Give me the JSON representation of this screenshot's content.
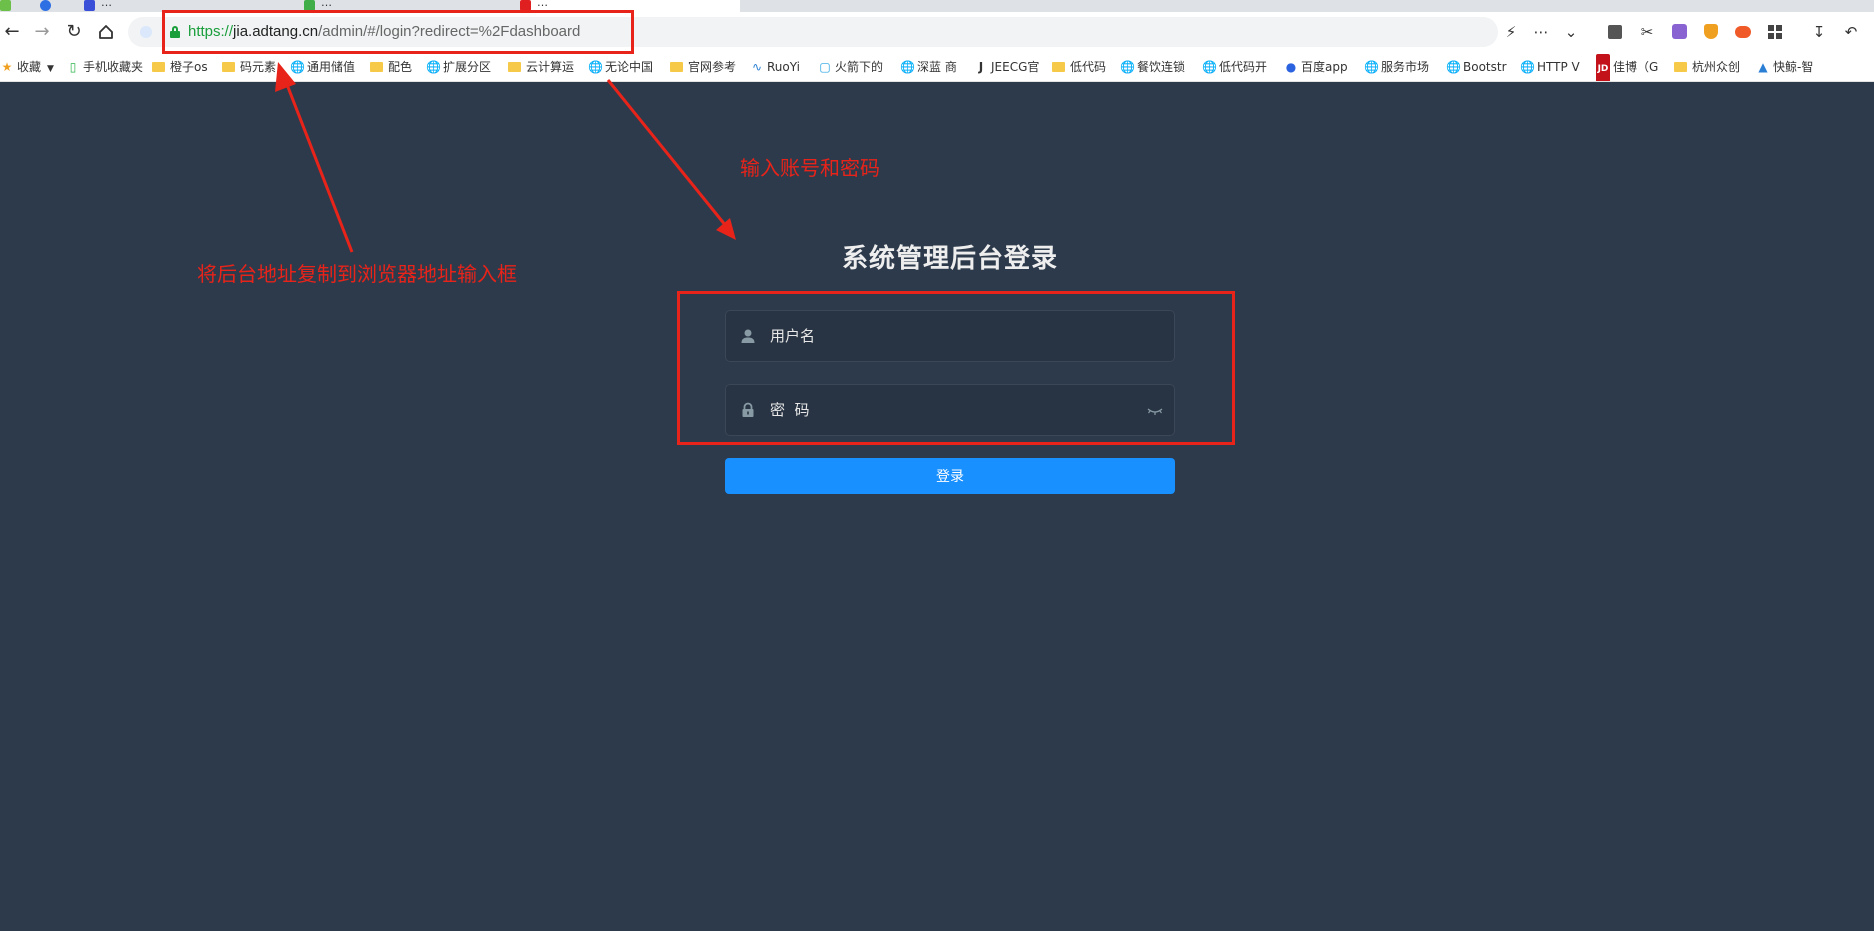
{
  "browser": {
    "tabs": [
      {
        "label": "…",
        "active": false
      },
      {
        "label": "…",
        "active": false
      },
      {
        "label": "…",
        "active": false
      },
      {
        "label": "…",
        "active": true
      }
    ],
    "url": {
      "scheme": "https://",
      "host": "jia.adtang.cn",
      "path": "/admin/#/login?redirect=%2Fdashboard"
    },
    "nav_icons": [
      "back-icon",
      "forward-icon",
      "reload-icon",
      "home-icon"
    ],
    "toolbar_icons": [
      "lightning-icon",
      "more-icon",
      "chevron-down-icon",
      "reader-icon",
      "scissors-icon",
      "translate-icon",
      "shield-icon",
      "game-icon",
      "apps-icon",
      "download-icon",
      "undo-icon"
    ],
    "bookmarks": [
      {
        "label": "收藏",
        "icon": "star-icon"
      },
      {
        "label": "手机收藏夹",
        "icon": "phone-icon"
      },
      {
        "label": "橙子os",
        "icon": "folder-icon"
      },
      {
        "label": "码元素",
        "icon": "folder-icon"
      },
      {
        "label": "通用储值",
        "icon": "globe-icon"
      },
      {
        "label": "配色",
        "icon": "folder-icon"
      },
      {
        "label": "扩展分区",
        "icon": "globe-icon"
      },
      {
        "label": "云计算运",
        "icon": "folder-icon"
      },
      {
        "label": "无论中国",
        "icon": "globe-icon"
      },
      {
        "label": "官网参考",
        "icon": "folder-icon"
      },
      {
        "label": "RuoYi",
        "icon": "ruoyi-icon"
      },
      {
        "label": "火箭下的",
        "icon": "bilibili-icon"
      },
      {
        "label": "深蓝 商",
        "icon": "globe-icon"
      },
      {
        "label": "JEECG官",
        "icon": "jeecg-icon"
      },
      {
        "label": "低代码",
        "icon": "folder-icon"
      },
      {
        "label": "餐饮连锁",
        "icon": "globe-icon"
      },
      {
        "label": "低代码开",
        "icon": "globe-icon"
      },
      {
        "label": "百度app",
        "icon": "baidu-icon"
      },
      {
        "label": "服务市场",
        "icon": "globe-icon"
      },
      {
        "label": "Bootstr",
        "icon": "globe-icon"
      },
      {
        "label": "HTTP V",
        "icon": "globe-icon"
      },
      {
        "label": "佳博（G",
        "icon": "jd-icon"
      },
      {
        "label": "杭州众创",
        "icon": "folder-icon"
      },
      {
        "label": "快鲸-智",
        "icon": "whale-icon"
      }
    ]
  },
  "page": {
    "title": "系统管理后台登录",
    "username_placeholder": "用户名",
    "password_placeholder": "密  码",
    "login_label": "登录"
  },
  "annotations": {
    "url_hint": "将后台地址复制到浏览器地址输入框",
    "credentials_hint": "输入账号和密码"
  },
  "colors": {
    "background": "#2d3a4b",
    "field_bg": "#283443",
    "button": "#1890ff",
    "annotation": "#e8231a"
  }
}
